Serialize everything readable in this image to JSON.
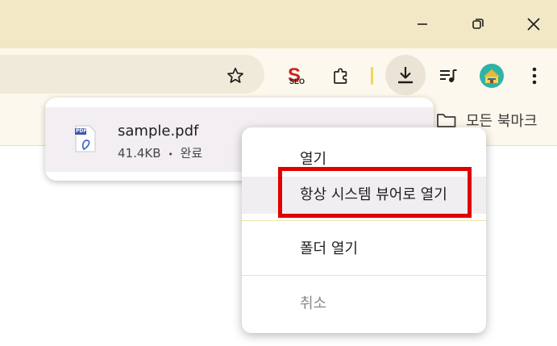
{
  "window": {
    "controls": [
      "minimize-icon",
      "restore-icon",
      "close-icon"
    ]
  },
  "toolbar": {
    "icons": [
      "star-icon",
      "seo-extension-icon",
      "extensions-puzzle-icon",
      "downloads-icon",
      "media-queue-icon",
      "profile-avatar-icon",
      "more-menu-icon"
    ],
    "seo_text": "SEO"
  },
  "bookmarks": {
    "all_bookmarks_label": "모든 북마크"
  },
  "downloads": {
    "items": [
      {
        "file_name": "sample.pdf",
        "size": "41.4KB",
        "separator": "•",
        "status": "완료",
        "pdf_badge": "PDF"
      }
    ]
  },
  "context_menu": {
    "items": [
      {
        "label": "열기"
      },
      {
        "label": "항상 시스템 뷰어로 열기"
      },
      {
        "label": "폴더 열기"
      },
      {
        "label": "취소"
      }
    ]
  },
  "colors": {
    "titlebar": "#f2e8c6",
    "toolbar": "#fcf8ed",
    "highlight": "#e00000"
  }
}
